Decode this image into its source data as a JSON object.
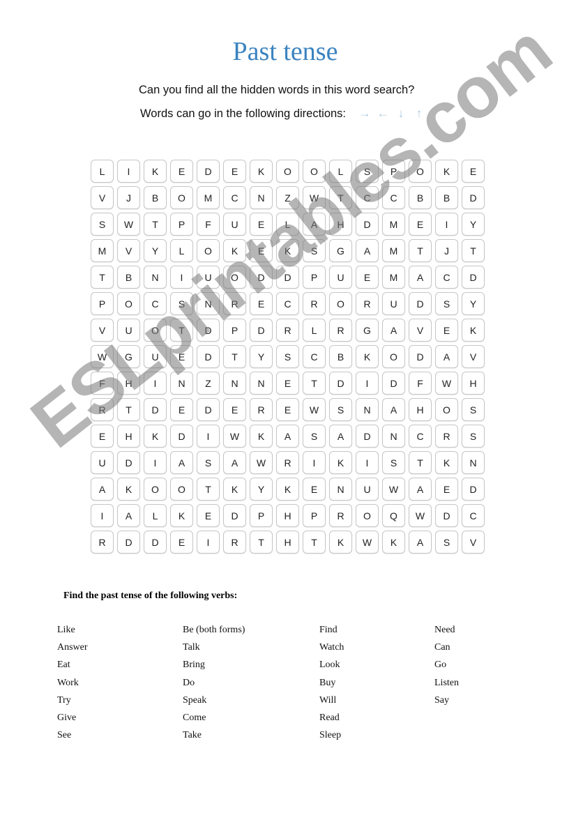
{
  "header": {
    "title": "Past tense",
    "subtitle": "Can you find all the hidden words in this word search?",
    "directions_label": "Words can go in the following directions:",
    "direction_icons": [
      "→",
      "←",
      "↓",
      "↑"
    ],
    "accent_color": "#3b83c0",
    "arrow_color": "#a9c8de"
  },
  "grid": {
    "rows": [
      "LIKEDEKOOLSPOKE",
      "VJBOMCNZWTCCBBD",
      "SWTPFUELAHDMEIY",
      "MVYLOKEKSGAMTJT",
      "TBNIUODDPUEMACD",
      "POCSNRECRORUDSY",
      "VUOTDPDRLRGAVEK",
      "WGUEDTYSCBKODAV",
      "FHINZNNETDIDFWH",
      "RTDEDEREWSNAHOS",
      "EHKDIWKASADNCRS",
      "UDIASAWRIKISTKN",
      "AKOOTKYKENUWAED",
      "IALKEDPHPROQWDC",
      "RDDEIRTHTKWKASV"
    ]
  },
  "instructions": "Find the past tense of the following verbs:",
  "verbs": {
    "col1": [
      "Like",
      "Answer",
      "Eat",
      "Work",
      "Try",
      "Give",
      "See"
    ],
    "col2": [
      "Be (both forms)",
      "Talk",
      "Bring",
      "Do",
      "Speak",
      "Come",
      "Take"
    ],
    "col3": [
      "Find",
      "Watch",
      "Look",
      "Buy",
      "Will",
      "Read",
      "Sleep"
    ],
    "col4": [
      "Need",
      "Can",
      "Go",
      "Listen",
      "Say"
    ]
  },
  "watermark": "ESLprintables.com"
}
